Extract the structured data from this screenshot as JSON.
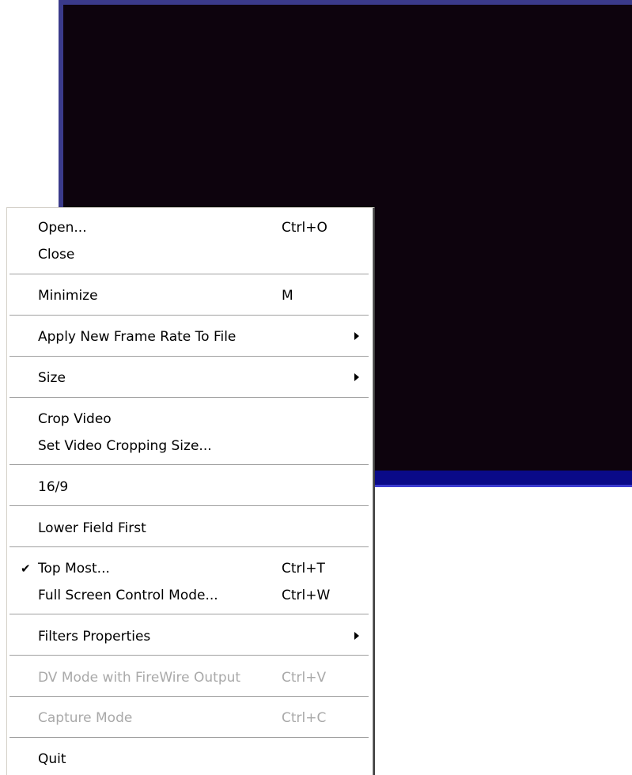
{
  "menu": {
    "open": {
      "label": "Open...",
      "shortcut": "Ctrl+O"
    },
    "close": {
      "label": "Close"
    },
    "minimize": {
      "label": "Minimize",
      "shortcut": "M"
    },
    "apply_frame_rate": {
      "label": "Apply New Frame Rate To File"
    },
    "size": {
      "label": "Size"
    },
    "crop_video": {
      "label": "Crop Video"
    },
    "set_cropping_size": {
      "label": "Set Video Cropping Size..."
    },
    "aspect": {
      "label": "16/9"
    },
    "lower_field_first": {
      "label": "Lower Field First"
    },
    "top_most": {
      "label": "Top Most...",
      "shortcut": "Ctrl+T",
      "check": "✔"
    },
    "full_screen": {
      "label": "Full Screen Control Mode...",
      "shortcut": "Ctrl+W"
    },
    "filters_properties": {
      "label": "Filters Properties"
    },
    "dv_mode": {
      "label": "DV Mode with FireWire Output",
      "shortcut": "Ctrl+V"
    },
    "capture_mode": {
      "label": "Capture Mode",
      "shortcut": "Ctrl+C"
    },
    "quit": {
      "label": "Quit"
    }
  },
  "colors": {
    "video_background": "#0d030d",
    "video_strip": "#0a0a88",
    "disabled_text": "#a9a9a9"
  }
}
